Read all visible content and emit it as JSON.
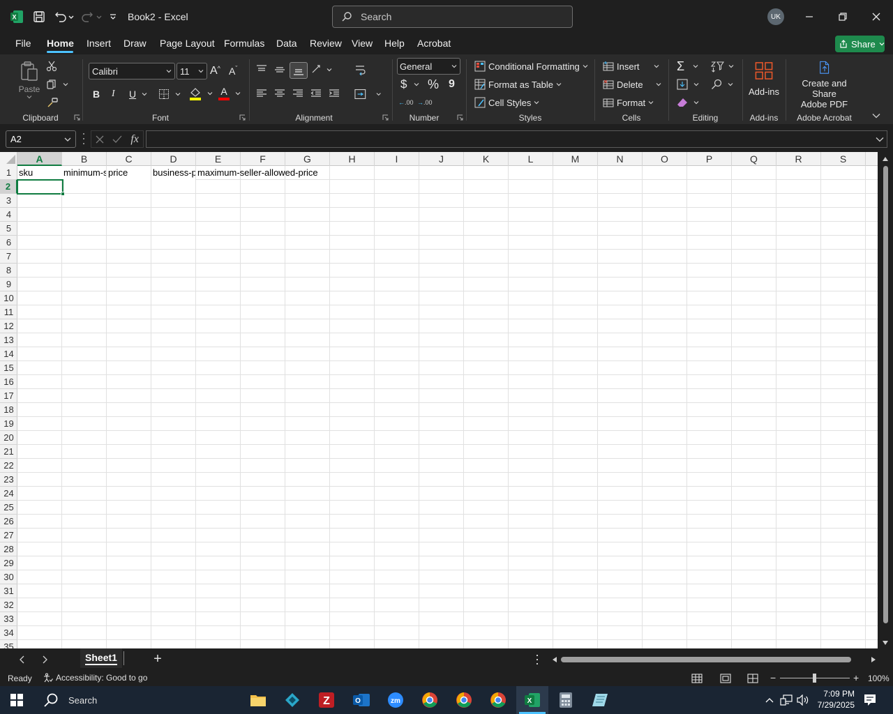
{
  "title_bar": {
    "doc_title": "Book2",
    "separator": "-",
    "app_name": "Excel",
    "search_placeholder": "Search",
    "user_initials": "UK"
  },
  "menu": {
    "items": [
      "File",
      "Home",
      "Insert",
      "Draw",
      "Page Layout",
      "Formulas",
      "Data",
      "Review",
      "View",
      "Help",
      "Acrobat"
    ],
    "active": "Home",
    "share_label": "Share"
  },
  "ribbon": {
    "clipboard": {
      "label": "Clipboard",
      "paste": "Paste"
    },
    "font": {
      "label": "Font",
      "name": "Calibri",
      "size": "11",
      "bold": "B",
      "italic": "I",
      "underline": "U",
      "grow_glyph": "A",
      "shrink_glyph": "A",
      "font_color_glyph": "A"
    },
    "alignment": {
      "label": "Alignment"
    },
    "number": {
      "label": "Number",
      "format": "General",
      "currency": "$",
      "percent": "%",
      "comma": "9",
      "inc_decimals": ".00",
      "dec_decimals": ".00"
    },
    "styles": {
      "label": "Styles",
      "conditional": "Conditional Formatting",
      "table": "Format as Table",
      "cell_styles": "Cell Styles"
    },
    "cells": {
      "label": "Cells",
      "insert": "Insert",
      "delete": "Delete",
      "format": "Format"
    },
    "editing": {
      "label": "Editing"
    },
    "addins": {
      "label": "Add-ins",
      "button": "Add-ins"
    },
    "acrobat": {
      "label": "Adobe Acrobat",
      "button_line1": "Create and Share",
      "button_line2": "Adobe PDF"
    }
  },
  "formula_bar": {
    "name_box": "A2",
    "fx": "fx",
    "value": ""
  },
  "sheet": {
    "columns": [
      "A",
      "B",
      "C",
      "D",
      "E",
      "F",
      "G",
      "H",
      "I",
      "J",
      "K",
      "L",
      "M",
      "N",
      "O",
      "P",
      "Q",
      "R",
      "S"
    ],
    "rows": [
      "1",
      "2",
      "3",
      "4",
      "5",
      "6",
      "7",
      "8",
      "9",
      "10",
      "11",
      "12",
      "13",
      "14",
      "15",
      "16",
      "17",
      "18",
      "19",
      "20",
      "21",
      "22",
      "23",
      "24",
      "25",
      "26",
      "27",
      "28",
      "29",
      "30",
      "31",
      "32",
      "33",
      "34",
      "35"
    ],
    "selected_cell": "A2",
    "cells": {
      "A1": "sku",
      "B1": "minimum-seller-allowed-price",
      "C1": "price",
      "D1": "business-price",
      "E1": "maximum-seller-allowed-price"
    }
  },
  "tabs": {
    "sheets": [
      "Sheet1"
    ],
    "active": "Sheet1",
    "add": "+"
  },
  "status": {
    "ready": "Ready",
    "accessibility": "Accessibility: Good to go",
    "zoom": "100%",
    "minus": "−",
    "plus": "+"
  },
  "taskbar": {
    "search": "Search",
    "time": "7:09 PM",
    "date": "7/29/2025",
    "apps": [
      "file-explorer",
      "app-blue",
      "filezilla",
      "outlook",
      "zoom",
      "chrome-1",
      "chrome-2",
      "chrome-3",
      "excel",
      "calculator",
      "notes-app"
    ]
  },
  "colors": {
    "accent_green": "#107c41",
    "share_green": "#1e8a4d",
    "tab_underline": "#4cc2ff"
  }
}
